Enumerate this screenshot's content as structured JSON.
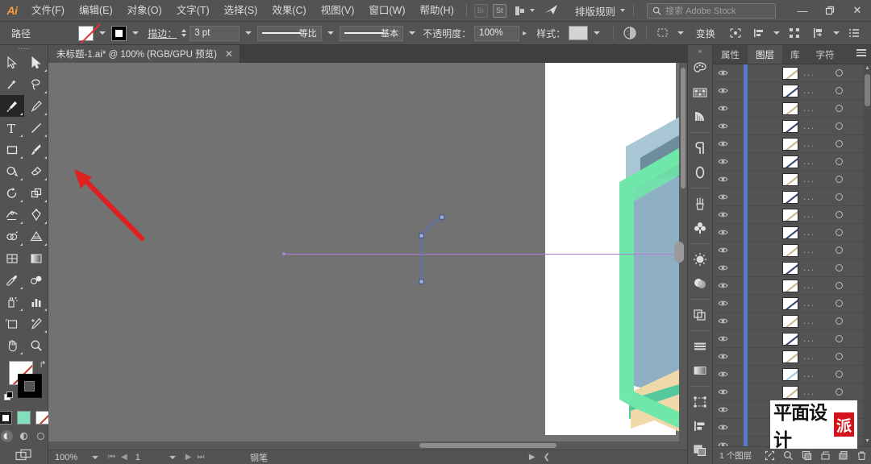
{
  "app": {
    "name": "Ai",
    "title": "Adobe Illustrator"
  },
  "menubar": {
    "items": [
      {
        "label": "文件(F)",
        "name": "menu-file"
      },
      {
        "label": "编辑(E)",
        "name": "menu-edit"
      },
      {
        "label": "对象(O)",
        "name": "menu-object"
      },
      {
        "label": "文字(T)",
        "name": "menu-type"
      },
      {
        "label": "选择(S)",
        "name": "menu-select"
      },
      {
        "label": "效果(C)",
        "name": "menu-effect"
      },
      {
        "label": "视图(V)",
        "name": "menu-view"
      },
      {
        "label": "窗口(W)",
        "name": "menu-window"
      },
      {
        "label": "帮助(H)",
        "name": "menu-help"
      }
    ],
    "br_badge": "Br",
    "st_badge": "St",
    "workspace": "排版规则",
    "search_placeholder": "搜索 Adobe Stock",
    "minimize": "—",
    "restore": "❐",
    "close": "✕"
  },
  "controlbar": {
    "object_label": "路径",
    "fill_label": "填色",
    "stroke_swatch_label": "描边颜色",
    "stroke_label": "描边：",
    "stroke_weight": "3 pt",
    "profile_label": "等比",
    "brush_label": "基本",
    "opacity_label": "不透明度：",
    "opacity_value": "100%",
    "style_label": "样式：",
    "transform_label": "变换",
    "recolor_label": "重新着色图稿",
    "align_label": "对齐",
    "more_label": "更多选项"
  },
  "document": {
    "tab_title": "未标题-1.ai* @ 100% (RGB/GPU 预览)",
    "close_glyph": "✕"
  },
  "toolbar": {
    "tools": [
      {
        "name": "selection-tool",
        "label": "选择工具",
        "selected": false
      },
      {
        "name": "direct-selection-tool",
        "label": "直接选择工具",
        "selected": false
      },
      {
        "name": "magic-wand-tool",
        "label": "魔棒工具",
        "selected": false
      },
      {
        "name": "lasso-tool",
        "label": "套索工具",
        "selected": false
      },
      {
        "name": "pen-tool",
        "label": "钢笔工具",
        "selected": true
      },
      {
        "name": "curvature-tool",
        "label": "曲率工具",
        "selected": false
      },
      {
        "name": "type-tool",
        "label": "文字工具",
        "selected": false
      },
      {
        "name": "line-segment-tool",
        "label": "直线段工具",
        "selected": false
      },
      {
        "name": "rectangle-tool",
        "label": "矩形工具",
        "selected": false
      },
      {
        "name": "paintbrush-tool",
        "label": "画笔工具",
        "selected": false
      },
      {
        "name": "shaper-tool",
        "label": "Shaper 工具",
        "selected": false
      },
      {
        "name": "eraser-tool",
        "label": "橡皮擦工具",
        "selected": false
      },
      {
        "name": "rotate-tool",
        "label": "旋转工具",
        "selected": false
      },
      {
        "name": "scale-tool",
        "label": "比例缩放工具",
        "selected": false
      },
      {
        "name": "width-tool",
        "label": "宽度工具",
        "selected": false
      },
      {
        "name": "free-transform-tool",
        "label": "自由变换工具",
        "selected": false
      },
      {
        "name": "shape-builder-tool",
        "label": "形状生成器工具",
        "selected": false
      },
      {
        "name": "perspective-grid-tool",
        "label": "透视网格工具",
        "selected": false
      },
      {
        "name": "mesh-tool",
        "label": "网格工具",
        "selected": false
      },
      {
        "name": "gradient-tool",
        "label": "渐变工具",
        "selected": false
      },
      {
        "name": "eyedropper-tool",
        "label": "吸管工具",
        "selected": false
      },
      {
        "name": "blend-tool",
        "label": "混合工具",
        "selected": false
      },
      {
        "name": "symbol-sprayer-tool",
        "label": "符号喷枪工具",
        "selected": false
      },
      {
        "name": "column-graph-tool",
        "label": "柱形图工具",
        "selected": false
      },
      {
        "name": "artboard-tool",
        "label": "画板工具",
        "selected": false
      },
      {
        "name": "slice-tool",
        "label": "切片工具",
        "selected": false
      },
      {
        "name": "hand-tool",
        "label": "抓手工具",
        "selected": false
      },
      {
        "name": "zoom-tool",
        "label": "缩放工具",
        "selected": false
      }
    ],
    "fill_label": "填色",
    "stroke_label": "描边",
    "swap_label": "互换填色和描边",
    "default_label": "默认填色和描边",
    "color_mode_label": "颜色",
    "gradient_mode_label": "渐变",
    "none_mode_label": "无",
    "draw_normal_label": "正常绘图",
    "draw_behind_label": "背面绘图",
    "draw_inside_label": "内部绘图",
    "screen_mode_label": "更改屏幕模式"
  },
  "canvas": {
    "background_color": "#727272",
    "artboard_color": "#ffffff",
    "guide_color": "#b07fd8",
    "path_color": "#5b72b8",
    "artwork_colors": {
      "mint": "#6ee7a8",
      "teal": "#55c89e",
      "bluegray": "#8fb0c4",
      "lightblue": "#a9c6d4",
      "tan": "#f0d9a8",
      "darkslate": "#6d8c9c"
    },
    "pointer_label": "红色箭头指示器",
    "pointer_color": "#e02020"
  },
  "statusbar": {
    "zoom": "100%",
    "page": "1",
    "tool_status": "钢笔",
    "first_label": "⏮",
    "prev_label": "◀",
    "next_label": "▶",
    "last_label": "⏭"
  },
  "icondock": {
    "items": [
      {
        "name": "color-panel-icon",
        "label": "颜色"
      },
      {
        "name": "swatches-panel-icon",
        "label": "色板"
      },
      {
        "name": "color-guide-panel-icon",
        "label": "颜色参考"
      },
      {
        "name": "paragraph-panel-icon",
        "label": "段落"
      },
      {
        "name": "character-panel-icon",
        "label": "字符"
      },
      {
        "name": "brushes-panel-icon",
        "label": "画笔"
      },
      {
        "name": "symbols-panel-icon",
        "label": "符号"
      },
      {
        "name": "appearance-panel-icon",
        "label": "外观"
      },
      {
        "name": "transparency-panel-icon",
        "label": "透明度"
      },
      {
        "name": "pathfinder-panel-icon",
        "label": "路径查找器"
      },
      {
        "name": "artboards-panel-icon",
        "label": "画板"
      },
      {
        "name": "align-panel-icon",
        "label": "对齐"
      },
      {
        "name": "layers-group-icon",
        "label": "图层组"
      },
      {
        "name": "gradient-panel-icon",
        "label": "渐变"
      },
      {
        "name": "transform-panel-icon",
        "label": "变换"
      },
      {
        "name": "stroke-panel-icon",
        "label": "描边"
      },
      {
        "name": "links-panel-icon",
        "label": "链接"
      }
    ]
  },
  "layers_panel": {
    "tabs": [
      {
        "label": "属性",
        "name": "tab-properties",
        "active": false
      },
      {
        "label": "图层",
        "name": "tab-layers",
        "active": true
      },
      {
        "label": "库",
        "name": "tab-libraries",
        "active": false
      },
      {
        "label": "字符",
        "name": "tab-character",
        "active": false
      }
    ],
    "row_name": "...",
    "rows": [
      {
        "thumb": "#c9b98a",
        "visible": true
      },
      {
        "thumb": "#33436e",
        "visible": true
      },
      {
        "thumb": "#c9b98a",
        "visible": true
      },
      {
        "thumb": "#33436e",
        "visible": true
      },
      {
        "thumb": "#c9b98a",
        "visible": true
      },
      {
        "thumb": "#33436e",
        "visible": true
      },
      {
        "thumb": "#c9b98a",
        "visible": true
      },
      {
        "thumb": "#33436e",
        "visible": true
      },
      {
        "thumb": "#c9b98a",
        "visible": true
      },
      {
        "thumb": "#33436e",
        "visible": true
      },
      {
        "thumb": "#c9b98a",
        "visible": true
      },
      {
        "thumb": "#33436e",
        "visible": true
      },
      {
        "thumb": "#c9b98a",
        "visible": true
      },
      {
        "thumb": "#33436e",
        "visible": true
      },
      {
        "thumb": "#c9b98a",
        "visible": true
      },
      {
        "thumb": "#33436e",
        "visible": true
      },
      {
        "thumb": "#c9b98a",
        "visible": true
      },
      {
        "thumb": "#9ec8e0",
        "visible": true
      },
      {
        "thumb": "#c9b98a",
        "visible": true
      },
      {
        "thumb": "#33436e",
        "visible": true
      },
      {
        "thumb": "#c9b98a",
        "visible": true
      },
      {
        "thumb": "#c9b98a",
        "visible": true
      }
    ],
    "footer_count": "1 个图层",
    "footer_buttons": [
      {
        "name": "locate-object-button",
        "label": "定位对象"
      },
      {
        "name": "make-clipping-mask-button",
        "label": "建立/释放剪切蒙版"
      },
      {
        "name": "make-sublayer-button",
        "label": "创建新子图层"
      },
      {
        "name": "new-layer-button",
        "label": "创建新图层"
      },
      {
        "name": "delete-layer-button",
        "label": "删除所选图层"
      }
    ]
  },
  "watermark": {
    "text": "平面设计",
    "badge": "派"
  }
}
